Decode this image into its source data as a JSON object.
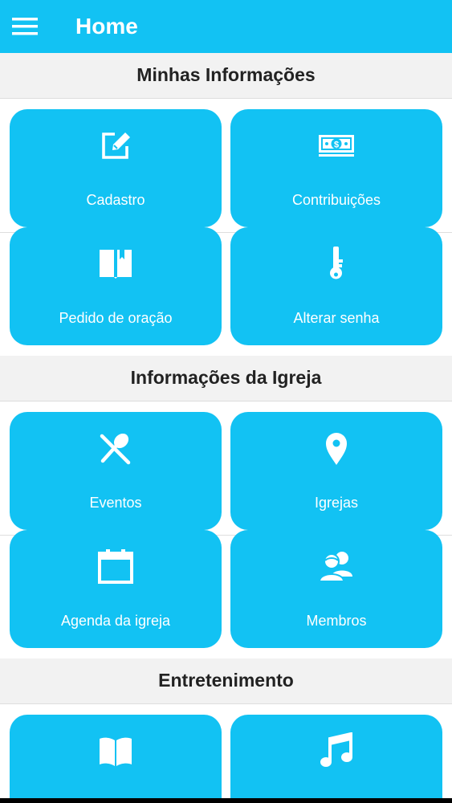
{
  "app": {
    "title": "Home",
    "accent_color": "#12c2f3",
    "menu_icon": "hamburger-menu-icon"
  },
  "sections": [
    {
      "title": "Minhas Informações",
      "tiles": [
        {
          "label": "Cadastro",
          "icon": "edit-icon"
        },
        {
          "label": "Contribuições",
          "icon": "money-bill-icon"
        },
        {
          "label": "Pedido de oração",
          "icon": "bookmark-book-icon"
        },
        {
          "label": "Alterar senha",
          "icon": "key-icon"
        }
      ]
    },
    {
      "title": "Informações da Igreja",
      "tiles": [
        {
          "label": "Eventos",
          "icon": "fork-spoon-icon"
        },
        {
          "label": "Igrejas",
          "icon": "map-pin-icon"
        },
        {
          "label": "Agenda da igreja",
          "icon": "calendar-icon"
        },
        {
          "label": "Membros",
          "icon": "users-icon"
        }
      ]
    },
    {
      "title": "Entretenimento",
      "tiles": [
        {
          "label": "",
          "icon": "open-book-icon"
        },
        {
          "label": "",
          "icon": "music-note-icon"
        }
      ]
    }
  ]
}
